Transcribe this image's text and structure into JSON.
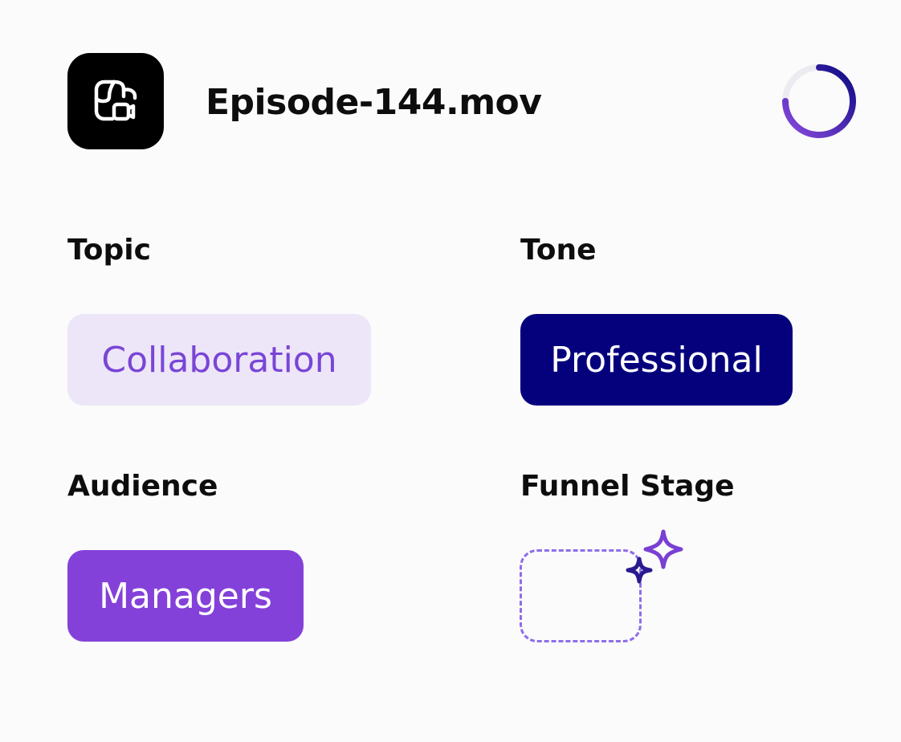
{
  "file": {
    "name": "Episode-144.mov",
    "icon": "video-file-icon"
  },
  "progress": {
    "icon": "progress-ring-icon",
    "colors": {
      "track": "#ecebf1",
      "start": "#0b0a82",
      "end": "#8c4ae0"
    }
  },
  "tags": {
    "topic": {
      "label": "Topic",
      "value": "Collaboration",
      "bg": "#ede6f8",
      "fg": "#7a45d6"
    },
    "tone": {
      "label": "Tone",
      "value": "Professional",
      "bg": "#05007c",
      "fg": "#ffffff"
    },
    "audience": {
      "label": "Audience",
      "value": "Managers",
      "bg": "#8441d9",
      "fg": "#ffffff"
    },
    "funnel_stage": {
      "label": "Funnel Stage",
      "value": "",
      "icon": "sparkles-icon",
      "border": "#8e6ee8"
    }
  }
}
